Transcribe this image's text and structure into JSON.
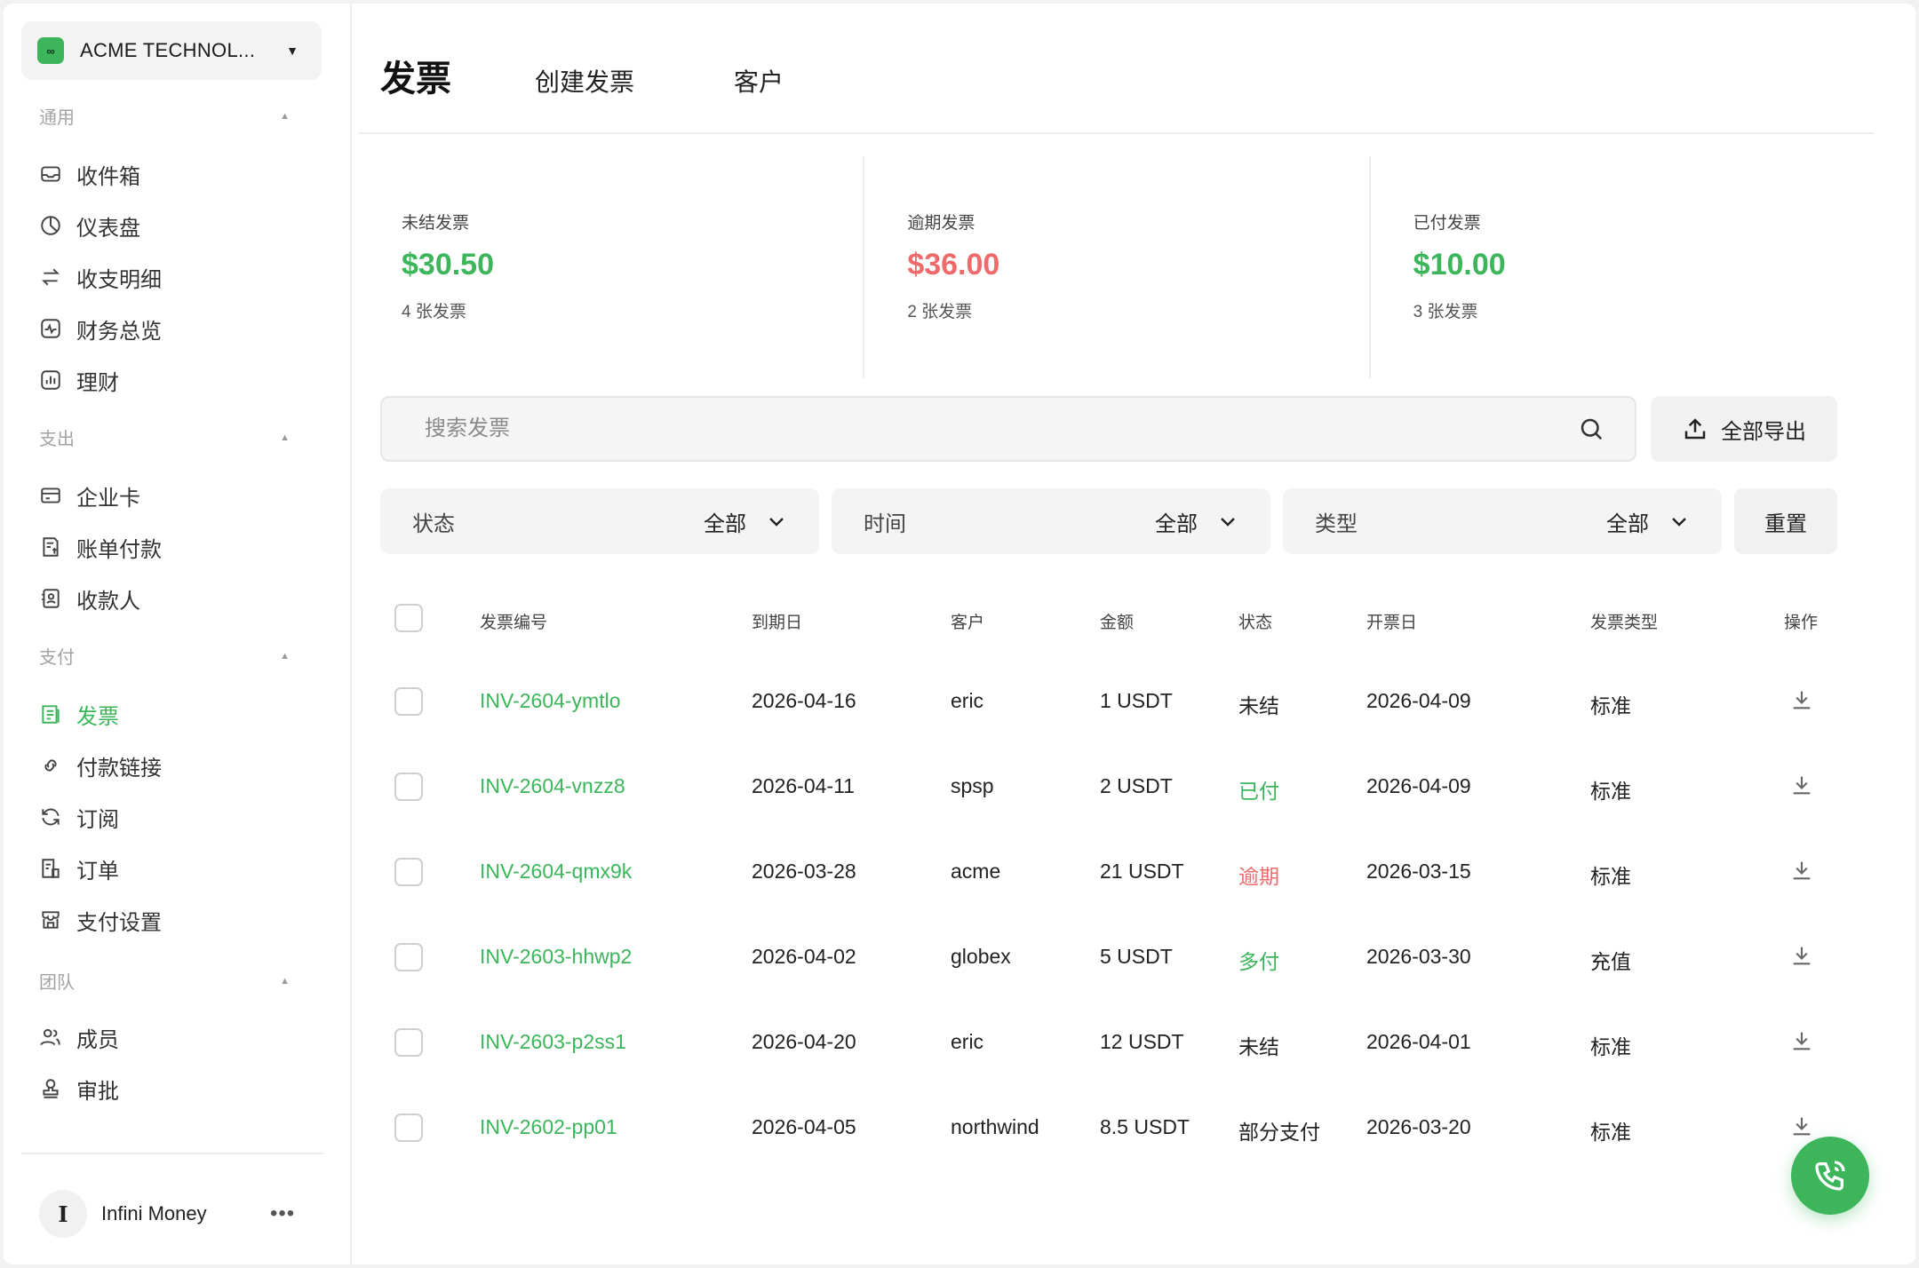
{
  "org": {
    "name": "ACME TECHNOL...",
    "logo": "∞"
  },
  "sections": {
    "general": "通用",
    "spend": "支出",
    "pay": "支付",
    "team": "团队"
  },
  "nav": {
    "inbox": "收件箱",
    "dashboard": "仪表盘",
    "transactions": "收支明细",
    "finance": "财务总览",
    "wealth": "理财",
    "cards": "企业卡",
    "bills": "账单付款",
    "payees": "收款人",
    "invoices": "发票",
    "paylinks": "付款链接",
    "subscriptions": "订阅",
    "orders": "订单",
    "paysettings": "支付设置",
    "members": "成员",
    "approvals": "审批"
  },
  "user": {
    "initial": "I",
    "name": "Infini Money",
    "more": "•••"
  },
  "tabs": {
    "title": "发票",
    "create": "创建发票",
    "customers": "客户"
  },
  "stats": [
    {
      "label": "未结发票",
      "value": "$30.50",
      "count": "4 张发票",
      "color": "#3cb55b"
    },
    {
      "label": "逾期发票",
      "value": "$36.00",
      "count": "2 张发票",
      "color": "#ef6a6a"
    },
    {
      "label": "已付发票",
      "value": "$10.00",
      "count": "3 张发票",
      "color": "#3cb55b"
    }
  ],
  "search": {
    "placeholder": "搜索发票"
  },
  "export_label": "全部导出",
  "filters": {
    "status": {
      "label": "状态",
      "value": "全部"
    },
    "time": {
      "label": "时间",
      "value": "全部"
    },
    "type": {
      "label": "类型",
      "value": "全部"
    },
    "reset": "重置"
  },
  "table": {
    "headers": {
      "id": "发票编号",
      "due": "到期日",
      "customer": "客户",
      "amount": "金额",
      "status": "状态",
      "issued": "开票日",
      "type": "发票类型",
      "action": "操作"
    },
    "rows": [
      {
        "id": "INV-2604-ymtlo",
        "due": "2026-04-16",
        "customer": "eric",
        "amount": "1 USDT",
        "status": "未结",
        "status_color": "#222222",
        "issued": "2026-04-09",
        "type": "标准"
      },
      {
        "id": "INV-2604-vnzz8",
        "due": "2026-04-11",
        "customer": "spsp",
        "amount": "2 USDT",
        "status": "已付",
        "status_color": "#3cb55b",
        "issued": "2026-04-09",
        "type": "标准"
      },
      {
        "id": "INV-2604-qmx9k",
        "due": "2026-03-28",
        "customer": "acme",
        "amount": "21 USDT",
        "status": "逾期",
        "status_color": "#ef6a6a",
        "issued": "2026-03-15",
        "type": "标准"
      },
      {
        "id": "INV-2603-hhwp2",
        "due": "2026-04-02",
        "customer": "globex",
        "amount": "5 USDT",
        "status": "多付",
        "status_color": "#3cb55b",
        "issued": "2026-03-30",
        "type": "充值"
      },
      {
        "id": "INV-2603-p2ss1",
        "due": "2026-04-20",
        "customer": "eric",
        "amount": "12 USDT",
        "status": "未结",
        "status_color": "#222222",
        "issued": "2026-04-01",
        "type": "标准"
      },
      {
        "id": "INV-2602-pp01",
        "due": "2026-04-05",
        "customer": "northwind",
        "amount": "8.5 USDT",
        "status": "部分支付",
        "status_color": "#222222",
        "issued": "2026-03-20",
        "type": "标准"
      }
    ]
  },
  "colors": {
    "accent": "#3cb55b",
    "danger": "#ef6a6a"
  }
}
